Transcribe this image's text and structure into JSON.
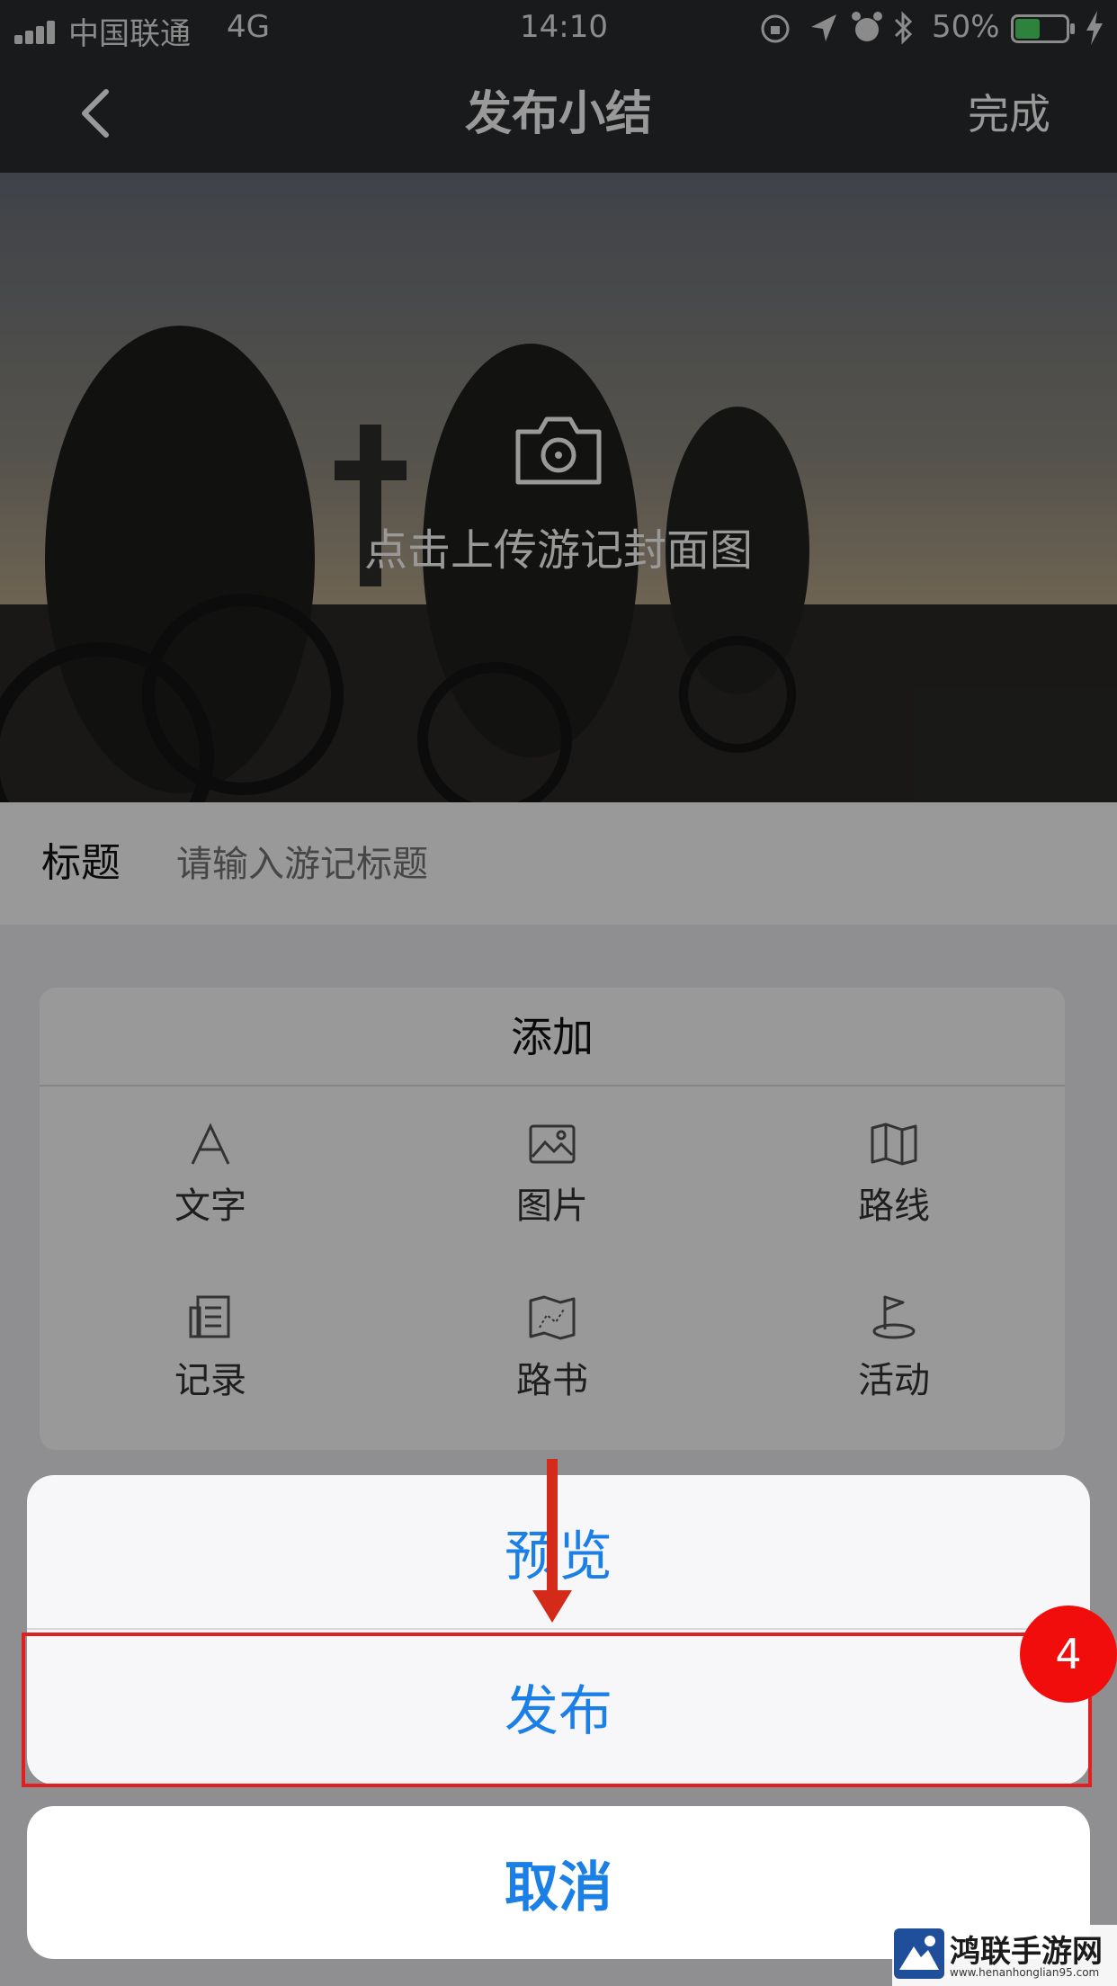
{
  "status_bar": {
    "carrier": "中国联通",
    "network": "4G",
    "time": "14:10",
    "battery_percent": "50%",
    "battery_level": 0.5
  },
  "nav": {
    "title": "发布小结",
    "done_label": "完成"
  },
  "cover": {
    "upload_hint": "点击上传游记封面图"
  },
  "title_field": {
    "label": "标题",
    "placeholder": "请输入游记标题"
  },
  "add_panel": {
    "title": "添加",
    "items": [
      {
        "label": "文字",
        "icon": "text-icon"
      },
      {
        "label": "图片",
        "icon": "image-icon"
      },
      {
        "label": "路线",
        "icon": "map-route-icon"
      },
      {
        "label": "记录",
        "icon": "record-icon"
      },
      {
        "label": "路书",
        "icon": "roadbook-icon"
      },
      {
        "label": "活动",
        "icon": "flag-icon"
      }
    ]
  },
  "action_sheet": {
    "preview_label": "预览",
    "publish_label": "发布",
    "cancel_label": "取消"
  },
  "annotation": {
    "step_number": "4"
  },
  "watermark": {
    "title": "鸿联手游网",
    "url": "www.henanhonglian95.com"
  },
  "colors": {
    "action_blue": "#1a7fe6",
    "annotation_red": "#e02020",
    "dark_header": "#2b2c2e"
  }
}
